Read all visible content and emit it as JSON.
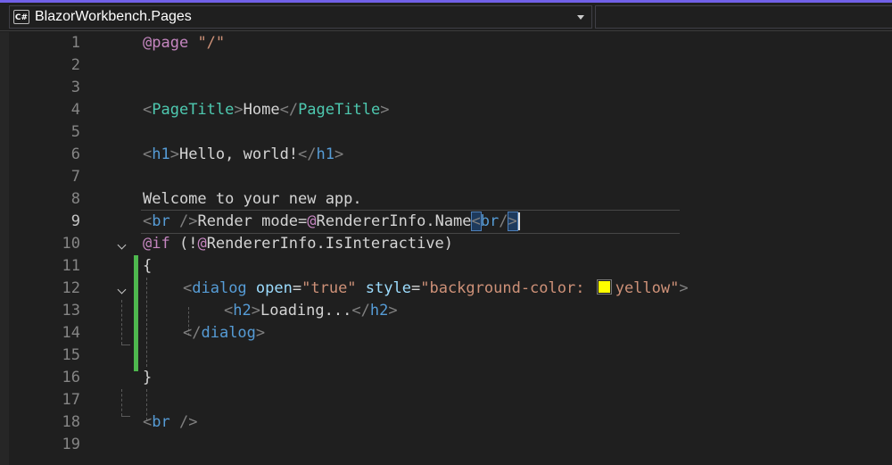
{
  "navbar": {
    "project_icon_label": "C#",
    "project_name": "BlazorWorkbench.Pages"
  },
  "editor": {
    "current_line": 9,
    "line_numbers": [
      "1",
      "2",
      "3",
      "4",
      "5",
      "6",
      "7",
      "8",
      "9",
      "10",
      "11",
      "12",
      "13",
      "14",
      "15",
      "16",
      "17",
      "18",
      "19"
    ],
    "lines": {
      "l1": {
        "directive": "@page",
        "value": "\"/\""
      },
      "l4": {
        "open_b": "<",
        "tag": "PageTitle",
        "close_b": ">",
        "text": "Home",
        "end_open_b": "</",
        "end_tag": "PageTitle",
        "end_close_b": ">"
      },
      "l6": {
        "open_b": "<",
        "tag": "h1",
        "close_b": ">",
        "text": "Hello, world!",
        "end_open_b": "</",
        "end_tag": "h1",
        "end_close_b": ">"
      },
      "l8": {
        "text": "Welcome to your new app."
      },
      "l9": {
        "br1_open": "<",
        "br1_tag": "br",
        "br1_close": " />",
        "text_prefix": "Render mode=",
        "razor_at": "@",
        "razor_expr": "RendererInfo.Name",
        "br2_open": "<",
        "br2_tag": "br",
        "br2_slash": "/",
        "br2_close": ">"
      },
      "l10": {
        "keyword": "@if",
        "condition_open": " (!",
        "razor_at": "@",
        "condition_expr": "RendererInfo.IsInteractive",
        "condition_close": ")"
      },
      "l11": {
        "brace": "{"
      },
      "l12": {
        "open_b": "<",
        "tag": "dialog",
        "attr1_name": "open",
        "eq1": "=",
        "attr1_value": "\"true\"",
        "attr2_name": "style",
        "eq2": "=",
        "attr2_value_start": "\"background-color: ",
        "color_swatch": "#ffff00",
        "attr2_value_end": "yellow\"",
        "close_b": ">"
      },
      "l13": {
        "open_b": "<",
        "tag": "h2",
        "close_b": ">",
        "text": "Loading...",
        "end_open_b": "</",
        "end_tag": "h2",
        "end_close_b": ">"
      },
      "l14": {
        "end_open_b": "</",
        "end_tag": "dialog",
        "end_close_b": ">"
      },
      "l16": {
        "brace": "}"
      },
      "l18": {
        "open_b": "<",
        "tag": "br",
        "close_b": " />"
      }
    }
  }
}
